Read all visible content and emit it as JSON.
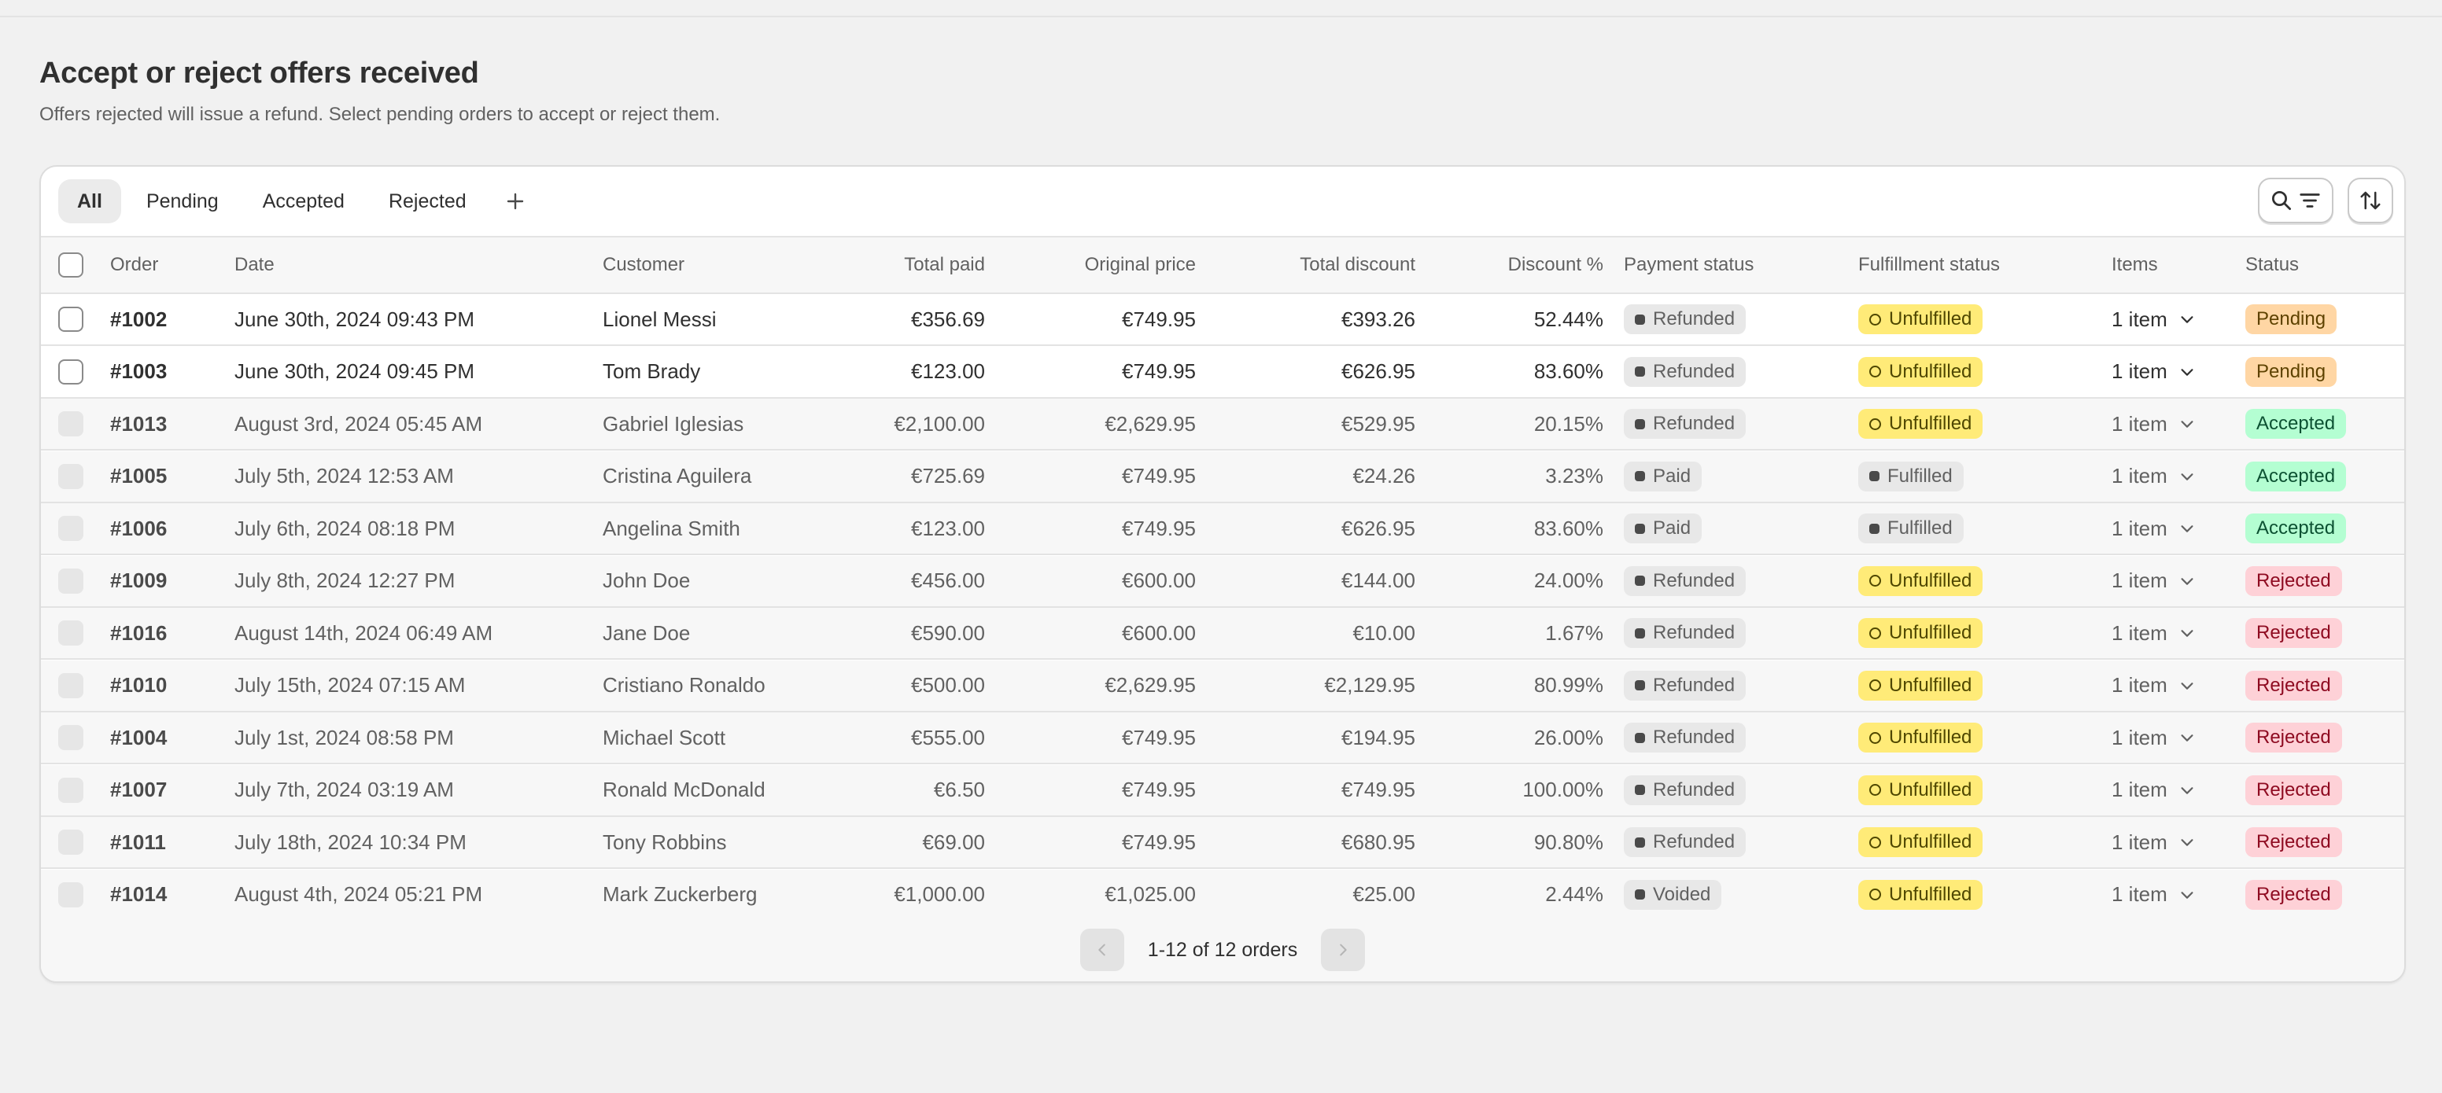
{
  "page": {
    "title": "Accept or reject offers received",
    "subtitle": "Offers rejected will issue a refund. Select pending orders to accept or reject them."
  },
  "tabs": [
    {
      "label": "All",
      "active": true
    },
    {
      "label": "Pending",
      "active": false
    },
    {
      "label": "Accepted",
      "active": false
    },
    {
      "label": "Rejected",
      "active": false
    }
  ],
  "toolbar": {
    "search_filter_icon": "search-filter-icon",
    "sort_icon": "sort-arrows-icon",
    "add_tab_icon": "plus-icon"
  },
  "table": {
    "headers": {
      "order": "Order",
      "date": "Date",
      "customer": "Customer",
      "total_paid": "Total paid",
      "original_price": "Original price",
      "total_discount": "Total discount",
      "discount_pct": "Discount %",
      "payment_status": "Payment status",
      "fulfillment_status": "Fulfillment status",
      "items": "Items",
      "status": "Status"
    },
    "rows": [
      {
        "order": "#1002",
        "date": "June 30th, 2024 09:43 PM",
        "customer": "Lionel Messi",
        "total_paid": "€356.69",
        "original_price": "€749.95",
        "total_discount": "€393.26",
        "discount_pct": "52.44%",
        "payment": "Refunded",
        "fulfillment": "Unfulfilled",
        "items": "1 item",
        "status": "Pending"
      },
      {
        "order": "#1003",
        "date": "June 30th, 2024 09:45 PM",
        "customer": "Tom Brady",
        "total_paid": "€123.00",
        "original_price": "€749.95",
        "total_discount": "€626.95",
        "discount_pct": "83.60%",
        "payment": "Refunded",
        "fulfillment": "Unfulfilled",
        "items": "1 item",
        "status": "Pending"
      },
      {
        "order": "#1013",
        "date": "August 3rd, 2024 05:45 AM",
        "customer": "Gabriel Iglesias",
        "total_paid": "€2,100.00",
        "original_price": "€2,629.95",
        "total_discount": "€529.95",
        "discount_pct": "20.15%",
        "payment": "Refunded",
        "fulfillment": "Unfulfilled",
        "items": "1 item",
        "status": "Accepted"
      },
      {
        "order": "#1005",
        "date": "July 5th, 2024 12:53 AM",
        "customer": "Cristina Aguilera",
        "total_paid": "€725.69",
        "original_price": "€749.95",
        "total_discount": "€24.26",
        "discount_pct": "3.23%",
        "payment": "Paid",
        "fulfillment": "Fulfilled",
        "items": "1 item",
        "status": "Accepted"
      },
      {
        "order": "#1006",
        "date": "July 6th, 2024 08:18 PM",
        "customer": "Angelina Smith",
        "total_paid": "€123.00",
        "original_price": "€749.95",
        "total_discount": "€626.95",
        "discount_pct": "83.60%",
        "payment": "Paid",
        "fulfillment": "Fulfilled",
        "items": "1 item",
        "status": "Accepted"
      },
      {
        "order": "#1009",
        "date": "July 8th, 2024 12:27 PM",
        "customer": "John Doe",
        "total_paid": "€456.00",
        "original_price": "€600.00",
        "total_discount": "€144.00",
        "discount_pct": "24.00%",
        "payment": "Refunded",
        "fulfillment": "Unfulfilled",
        "items": "1 item",
        "status": "Rejected"
      },
      {
        "order": "#1016",
        "date": "August 14th, 2024 06:49 AM",
        "customer": "Jane Doe",
        "total_paid": "€590.00",
        "original_price": "€600.00",
        "total_discount": "€10.00",
        "discount_pct": "1.67%",
        "payment": "Refunded",
        "fulfillment": "Unfulfilled",
        "items": "1 item",
        "status": "Rejected"
      },
      {
        "order": "#1010",
        "date": "July 15th, 2024 07:15 AM",
        "customer": "Cristiano Ronaldo",
        "total_paid": "€500.00",
        "original_price": "€2,629.95",
        "total_discount": "€2,129.95",
        "discount_pct": "80.99%",
        "payment": "Refunded",
        "fulfillment": "Unfulfilled",
        "items": "1 item",
        "status": "Rejected"
      },
      {
        "order": "#1004",
        "date": "July 1st, 2024 08:58 PM",
        "customer": "Michael Scott",
        "total_paid": "€555.00",
        "original_price": "€749.95",
        "total_discount": "€194.95",
        "discount_pct": "26.00%",
        "payment": "Refunded",
        "fulfillment": "Unfulfilled",
        "items": "1 item",
        "status": "Rejected"
      },
      {
        "order": "#1007",
        "date": "July 7th, 2024 03:19 AM",
        "customer": "Ronald McDonald",
        "total_paid": "€6.50",
        "original_price": "€749.95",
        "total_discount": "€749.95",
        "discount_pct": "100.00%",
        "payment": "Refunded",
        "fulfillment": "Unfulfilled",
        "items": "1 item",
        "status": "Rejected"
      },
      {
        "order": "#1011",
        "date": "July 18th, 2024 10:34 PM",
        "customer": "Tony Robbins",
        "total_paid": "€69.00",
        "original_price": "€749.95",
        "total_discount": "€680.95",
        "discount_pct": "90.80%",
        "payment": "Refunded",
        "fulfillment": "Unfulfilled",
        "items": "1 item",
        "status": "Rejected"
      },
      {
        "order": "#1014",
        "date": "August 4th, 2024 05:21 PM",
        "customer": "Mark Zuckerberg",
        "total_paid": "€1,000.00",
        "original_price": "€1,025.00",
        "total_discount": "€25.00",
        "discount_pct": "2.44%",
        "payment": "Voided",
        "fulfillment": "Unfulfilled",
        "items": "1 item",
        "status": "Rejected"
      }
    ]
  },
  "pagination": {
    "label": "1-12 of 12 orders",
    "prev_icon": "chevron-left-icon",
    "next_icon": "chevron-right-icon"
  },
  "colors": {
    "pending_bg": "#ffd6a4",
    "pending_fg": "#5e4200",
    "accepted_bg": "#b4fed2",
    "accepted_fg": "#0c5132",
    "rejected_bg": "#fed1d7",
    "rejected_fg": "#8e0b21",
    "unfulfilled_bg": "#ffeb78",
    "neutral_bg": "#e8e8e8"
  }
}
